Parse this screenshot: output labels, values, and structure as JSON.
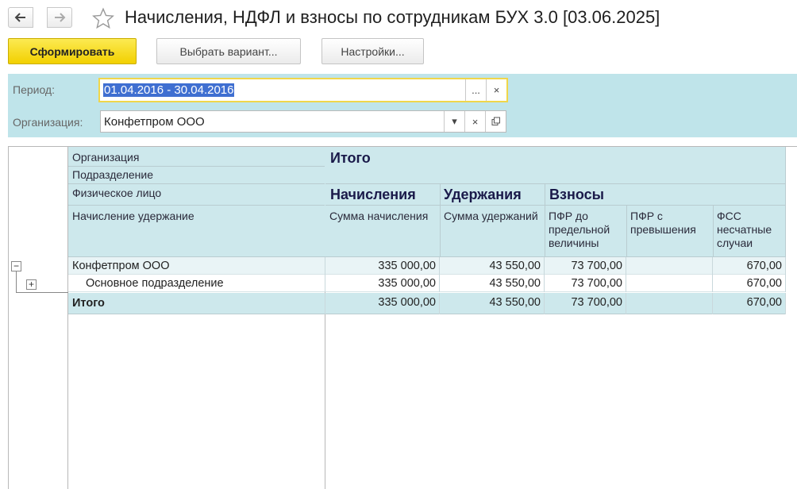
{
  "window": {
    "title": "Начисления, НДФЛ и взносы по сотрудникам БУХ 3.0 [03.06.2025]"
  },
  "toolbar": {
    "generate_label": "Сформировать",
    "choose_variant_label": "Выбрать вариант...",
    "settings_label": "Настройки..."
  },
  "filters": {
    "period_label": "Период:",
    "period_value": "01.04.2016 - 30.04.2016",
    "period_select_label": "...",
    "clear_label": "×",
    "org_label": "Организация:",
    "org_value": "Конфетпром ООО",
    "dropdown_label": "▾"
  },
  "report": {
    "grouping_headers": [
      "Организация",
      "Подразделение",
      "Физическое лицо",
      "Начисление удержание"
    ],
    "total_header": "Итого",
    "group_accruals": "Начисления",
    "group_deductions": "Удержания",
    "group_contributions": "Взносы",
    "columns": [
      "Сумма начисления",
      "Сумма удержаний",
      "ПФР до предельной величины",
      "ПФР с превышения",
      "ФСС несчатные случаи"
    ],
    "rows": [
      {
        "name": "Конфетпром ООО",
        "values": [
          "335 000,00",
          "43 550,00",
          "73 700,00",
          "",
          "670,00"
        ]
      },
      {
        "name": "Основное подразделение",
        "values": [
          "335 000,00",
          "43 550,00",
          "73 700,00",
          "",
          "670,00"
        ]
      }
    ],
    "total_row": {
      "name": "Итого",
      "values": [
        "335 000,00",
        "43 550,00",
        "73 700,00",
        "",
        "670,00"
      ]
    }
  },
  "colors": {
    "primary_button": "#f5d800",
    "filter_bg": "#bfe4ea",
    "header_bg": "#cde8ec",
    "selection": "#3f6fd1"
  }
}
